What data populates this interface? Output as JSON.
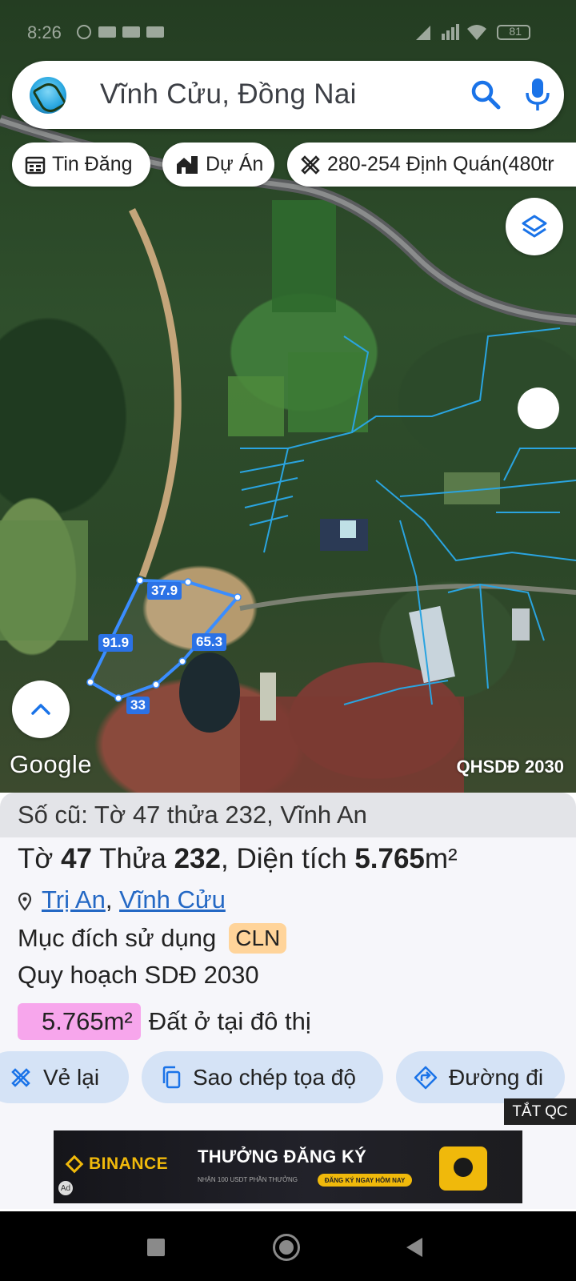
{
  "status_bar": {
    "time": "8:26",
    "battery": "81"
  },
  "search": {
    "location": "Vĩnh Cửu, Đồng Nai"
  },
  "chips": [
    {
      "label": "Tin Đăng",
      "icon": "calendar-icon"
    },
    {
      "label": "Dự Án",
      "icon": "building-icon"
    },
    {
      "label": "280-254 Định Quán(480tr",
      "icon": "ruler-icon"
    }
  ],
  "map": {
    "edge_labels": [
      "37.9",
      "91.9",
      "65.3",
      "33"
    ],
    "brand": "Google",
    "layer_label": "QHSDĐ 2030",
    "parcel_outline_color": "#3a8dff",
    "boundary_color": "#2aa4e0"
  },
  "parcel": {
    "old_number": "Số cũ: Tờ 47 thửa 232, Vĩnh An",
    "sheet_label": "Tờ",
    "sheet": "47",
    "plot_label": "Thửa",
    "plot": "232",
    "area_label": ", Diện tích",
    "area": "5.765",
    "area_unit": "m²",
    "ward": "Trị An",
    "separator": ", ",
    "district": "Vĩnh Cửu",
    "purpose_label": "Mục đích sử dụng",
    "purpose_code": "CLN",
    "plan_label": "Quy hoạch SDĐ 2030",
    "plan_area": "5.765m²",
    "plan_type": "Đất ở tại đô thị",
    "plan_badge_color": "#f7a6ec",
    "purpose_badge_color": "#ffd49a"
  },
  "actions": [
    {
      "label": "Vẻ lại",
      "icon": "redraw-icon"
    },
    {
      "label": "Sao chép tọa độ",
      "icon": "copy-icon"
    },
    {
      "label": "Đường đi",
      "icon": "directions-icon"
    }
  ],
  "ad": {
    "close_label": "TẮT QC",
    "brand": "BINANCE",
    "headline": "THƯỞNG ĐĂNG KÝ",
    "subtext": "NHẬN 100 USDT PHẦN THƯỞNG",
    "cta": "ĐĂNG KÝ NGAY HÔM NAY",
    "badge": "Ad"
  },
  "accent_color": "#1a73e8"
}
